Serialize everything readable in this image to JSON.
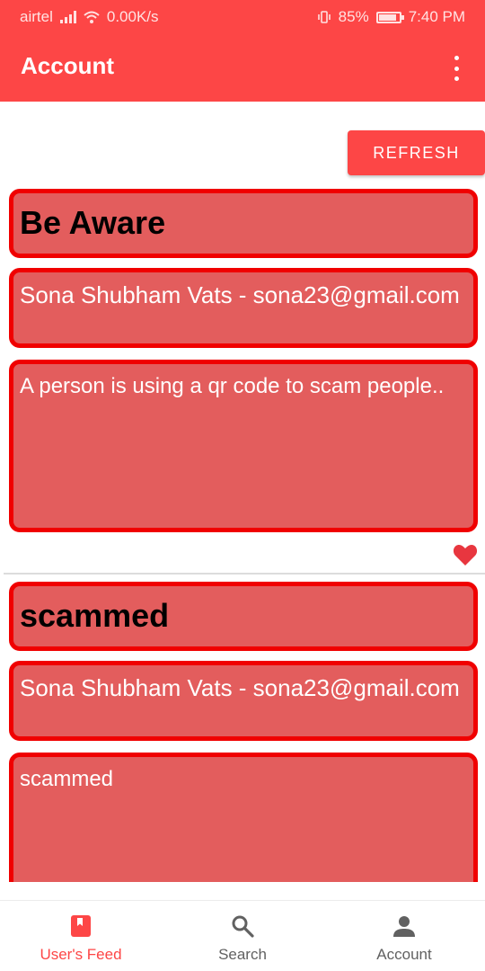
{
  "status_bar": {
    "carrier": "airtel",
    "speed": "0.00K/s",
    "battery": "85%",
    "time": "7:40 PM"
  },
  "toolbar": {
    "title": "Account",
    "overflow_icon": "more-vert-icon"
  },
  "refresh_button": {
    "label": "REFRESH"
  },
  "posts": [
    {
      "title": "Be Aware",
      "author": "Sona Shubham Vats - sona23@gmail.com",
      "body": "A person is using a qr code to scam people..",
      "liked": true
    },
    {
      "title": "scammed",
      "author": "Sona Shubham Vats - sona23@gmail.com",
      "body": "scammed",
      "liked": false
    }
  ],
  "bottom_nav": {
    "items": [
      {
        "label": "User's Feed",
        "icon": "book-icon",
        "active": true
      },
      {
        "label": "Search",
        "icon": "search-icon",
        "active": false
      },
      {
        "label": "Account",
        "icon": "person-icon",
        "active": false
      }
    ]
  },
  "colors": {
    "accent": "#fd4646",
    "card_fill": "#e35d5d",
    "card_border": "#f00000"
  }
}
